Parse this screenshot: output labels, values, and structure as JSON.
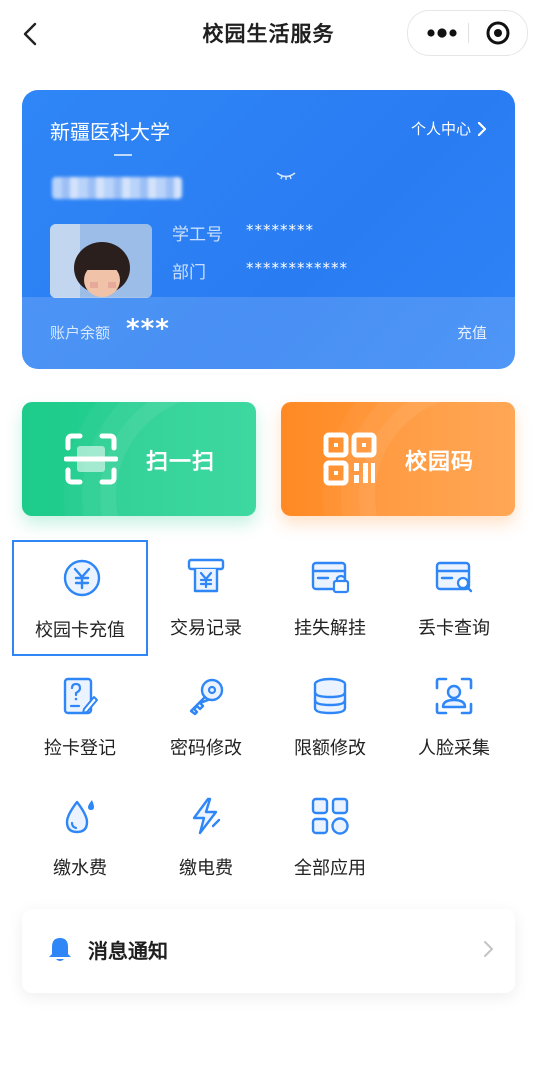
{
  "topbar": {
    "title": "校园生活服务"
  },
  "card": {
    "school": "新疆医科大学",
    "personal_center": "个人中心",
    "student_id_label": "学工号",
    "student_id_value": "********",
    "department_label": "部门",
    "department_value": "************",
    "balance_label": "账户余额",
    "balance_value": "***",
    "recharge": "充值"
  },
  "actions": {
    "scan": "扫一扫",
    "campus_code": "校园码"
  },
  "services": [
    {
      "label": "校园卡充值",
      "icon": "yen-circle-icon"
    },
    {
      "label": "交易记录",
      "icon": "receipt-icon"
    },
    {
      "label": "挂失解挂",
      "icon": "card-lock-icon"
    },
    {
      "label": "丢卡查询",
      "icon": "card-search-icon"
    },
    {
      "label": "捡卡登记",
      "icon": "document-edit-icon"
    },
    {
      "label": "密码修改",
      "icon": "key-icon"
    },
    {
      "label": "限额修改",
      "icon": "database-icon"
    },
    {
      "label": "人脸采集",
      "icon": "face-scan-icon"
    },
    {
      "label": "缴水费",
      "icon": "water-drop-icon"
    },
    {
      "label": "缴电费",
      "icon": "lightning-icon"
    },
    {
      "label": "全部应用",
      "icon": "grid-apps-icon"
    }
  ],
  "notice": {
    "label": "消息通知",
    "icon": "bell-icon"
  },
  "colors": {
    "primary": "#2f86f6",
    "green": "#1dcb8a",
    "orange": "#ff8a24"
  }
}
